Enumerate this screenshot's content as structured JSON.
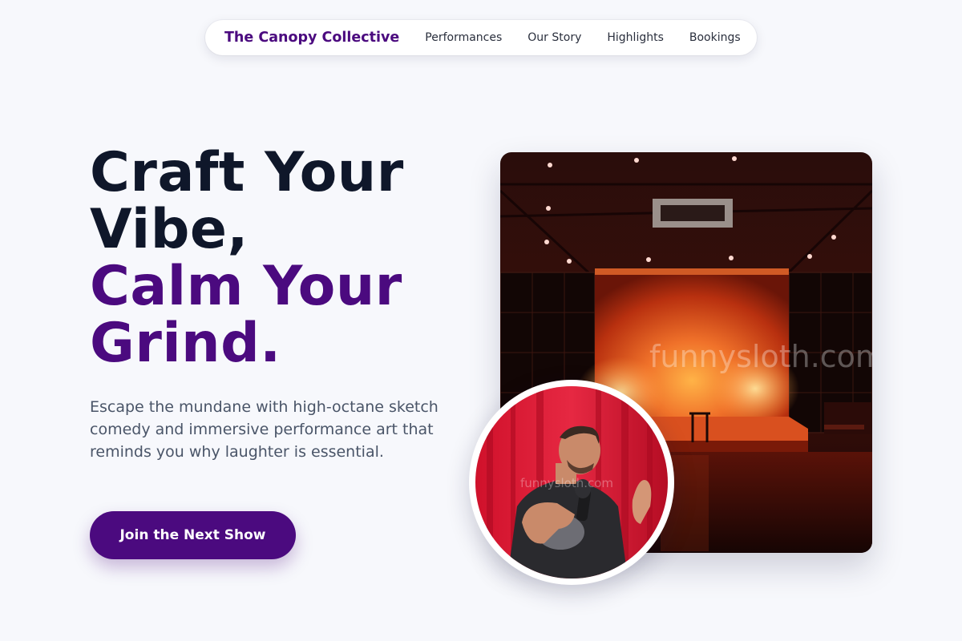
{
  "nav": {
    "brand": "The Canopy Collective",
    "links": [
      "Performances",
      "Our Story",
      "Highlights",
      "Bookings"
    ]
  },
  "hero": {
    "title_line1": "Craft Your",
    "title_line2": "Vibe,",
    "title_line3": "Calm Your",
    "title_line4": "Grind.",
    "subtitle": "Escape the mundane with high-octane sketch comedy and immersive performance art that reminds you why laughter is essential.",
    "cta_label": "Join the Next Show"
  },
  "images": {
    "stage_watermark": "funnysloth.com",
    "performer_watermark": "funnysloth.com"
  },
  "colors": {
    "brand": "#4b0a7f",
    "heading": "#0f172a",
    "body_text": "#4a5568",
    "background": "#f7f8fc"
  }
}
